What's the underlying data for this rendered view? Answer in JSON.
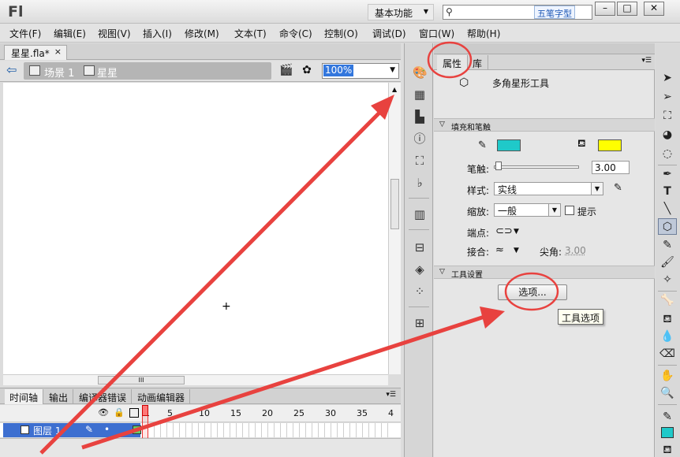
{
  "titlebar": {
    "logo": "Fl",
    "workspace": "基本功能",
    "search_placeholder": "",
    "ime_label": "五笔字型",
    "window_buttons": [
      "–",
      "□",
      "✕"
    ]
  },
  "menu": [
    "文件(F)",
    "编辑(E)",
    "视图(V)",
    "插入(I)",
    "修改(M)",
    "文本(T)",
    "命令(C)",
    "控制(O)",
    "调试(D)",
    "窗口(W)",
    "帮助(H)"
  ],
  "document": {
    "tab_label": "星星.fla*",
    "tab_close": "×",
    "breadcrumb": [
      "场景 1",
      "星星"
    ],
    "zoom": "100%"
  },
  "timeline": {
    "tabs": [
      "时间轴",
      "输出",
      "编译器错误",
      "动画编辑器"
    ],
    "frame_numbers": [
      "1",
      "5",
      "10",
      "15",
      "20",
      "25",
      "30",
      "35",
      "4"
    ],
    "layer_name": "图层 1"
  },
  "dock_icons": [
    "color-icon",
    "swatches-icon",
    "align-icon",
    "info-icon",
    "transform-icon",
    "history-icon",
    "library-icon",
    "components-icon",
    "3d-icon",
    "motion-icon",
    "project-icon"
  ],
  "properties": {
    "tabs": [
      "属性",
      "库"
    ],
    "tool_name": "多角星形工具",
    "section_fill_stroke": "填充和笔触",
    "stroke_color": "#1fc9c9",
    "fill_color": "#ffff00",
    "stroke_label": "笔触:",
    "stroke_value": "3.00",
    "style_label": "样式:",
    "style_value": "实线",
    "scale_label": "缩放:",
    "scale_value": "一般",
    "hint_label": "提示",
    "cap_label": "端点:",
    "join_label": "接合:",
    "miter_label": "尖角:",
    "miter_value": "3.00",
    "section_tool_settings": "工具设置",
    "options_button": "选项...",
    "tooltip": "工具选项"
  },
  "tools": [
    "selection-tool",
    "subselection-tool",
    "free-transform-tool",
    "3d-rotation-tool",
    "lasso-tool",
    "pen-tool",
    "text-tool",
    "line-tool",
    "polystar-tool",
    "pencil-tool",
    "brush-tool",
    "deco-tool",
    "bone-tool",
    "paint-bucket-tool",
    "eyedropper-tool",
    "eraser-tool",
    "hand-tool",
    "zoom-tool",
    "stroke-color-tool",
    "fill-color-swatch",
    "fill-bucket-tool"
  ],
  "annotation_color": "#e8423f"
}
